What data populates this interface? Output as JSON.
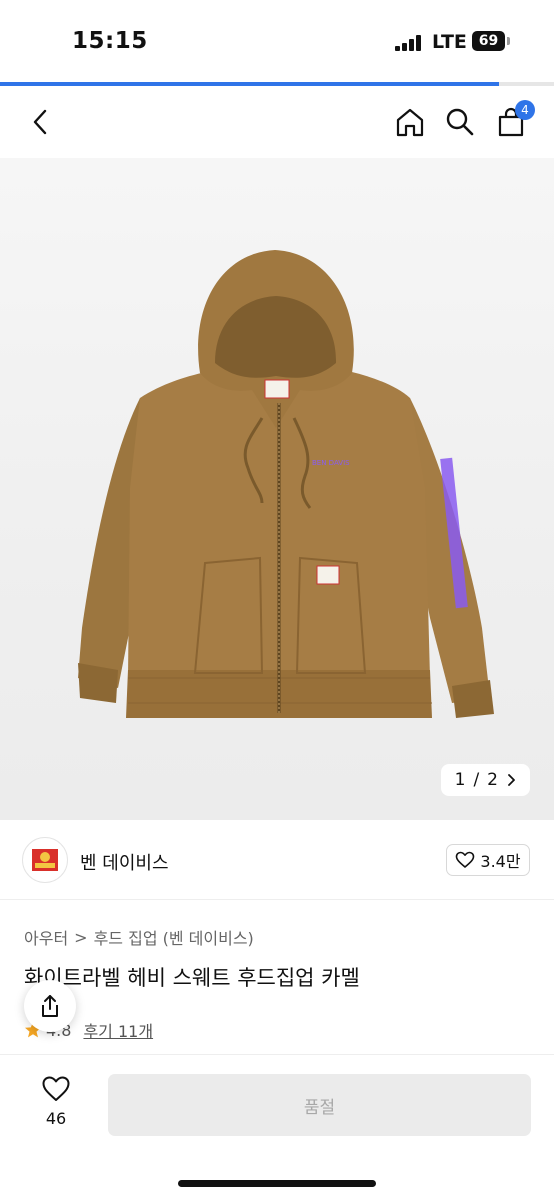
{
  "status_bar": {
    "time": "15:15",
    "network": "LTE",
    "battery": "69"
  },
  "page_load": {
    "progress": 0.9
  },
  "nav": {
    "back_icon": "chevron-left-icon",
    "home_icon": "home-icon",
    "search_icon": "search-icon",
    "cart_icon": "shopping-bag-icon",
    "cart_count": "4"
  },
  "gallery": {
    "current": "1",
    "separator": "/",
    "total": "2",
    "next_icon": "chevron-right-icon"
  },
  "brand": {
    "name": "벤 데이비스",
    "likes": "3.4만",
    "heart_icon": "heart-icon"
  },
  "breadcrumb": {
    "category": "아우터",
    "separator": ">",
    "subcategory": "후드 집업 (벤 데이비스)"
  },
  "product": {
    "title": "화이트라벨 헤비 스웨트 후드집업 카멜",
    "rating": "4.8",
    "reviews": "후기 11개"
  },
  "share_icon": "share-icon",
  "bottom_bar": {
    "wish_count": "46",
    "purchase_label": "품절"
  },
  "colors": {
    "accent": "#2f74e8",
    "product": "#a07a45",
    "print": "#8a5cf0",
    "star": "#f5a623"
  }
}
